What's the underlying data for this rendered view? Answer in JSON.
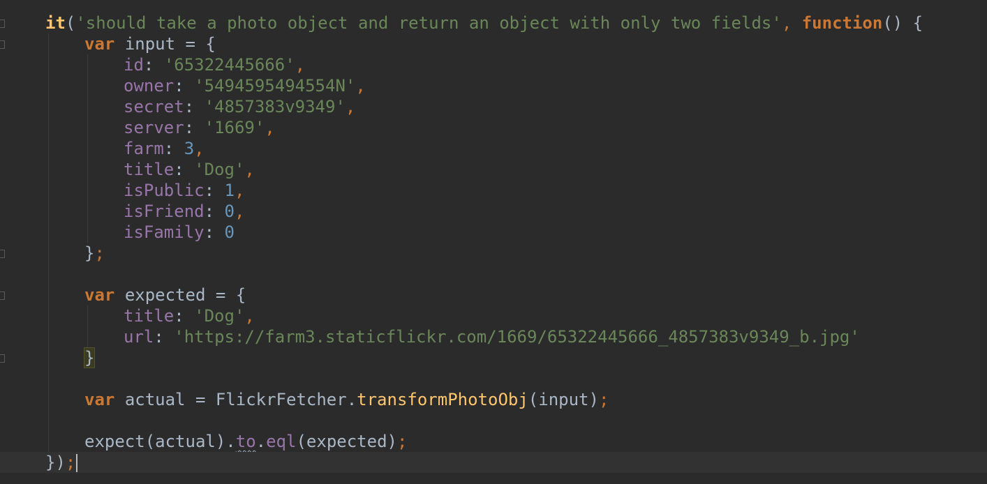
{
  "code": {
    "line1": {
      "it_fn": "it",
      "open_paren": "(",
      "description": "'should take a photo object and return an object with only two fields'",
      "comma": ",",
      "function_kw": "function",
      "parens_brace": "() {"
    },
    "line2": {
      "var_kw": "var",
      "decl": "input = {"
    },
    "input_props": [
      {
        "key": "id",
        "value": "'65322445666'",
        "sep": ",",
        "type": "string"
      },
      {
        "key": "owner",
        "value": "'5494595494554N'",
        "sep": ",",
        "type": "string"
      },
      {
        "key": "secret",
        "value": "'4857383v9349'",
        "sep": ",",
        "type": "string"
      },
      {
        "key": "server",
        "value": "'1669'",
        "sep": ",",
        "type": "string"
      },
      {
        "key": "farm",
        "value": "3",
        "sep": ",",
        "type": "number"
      },
      {
        "key": "title",
        "value": "'Dog'",
        "sep": ",",
        "type": "string"
      },
      {
        "key": "isPublic",
        "value": "1",
        "sep": ",",
        "type": "number"
      },
      {
        "key": "isFriend",
        "value": "0",
        "sep": ",",
        "type": "number"
      },
      {
        "key": "isFamily",
        "value": "0",
        "sep": "",
        "type": "number"
      }
    ],
    "input_close": {
      "brace": "}",
      "semi": ";"
    },
    "expected_decl": {
      "var_kw": "var",
      "decl": "expected = {"
    },
    "expected_props": [
      {
        "key": "title",
        "value": "'Dog'",
        "sep": ","
      },
      {
        "key": "url",
        "value": "'https://farm3.staticflickr.com/1669/65322445666_4857383v9349_b.jpg'",
        "sep": ""
      }
    ],
    "expected_close": {
      "brace": "}"
    },
    "actual_decl": {
      "var_kw": "var",
      "name": "actual = FlickrFetcher.",
      "method": "transformPhotoObj",
      "args": "(input)",
      "semi": ";"
    },
    "expect_line": {
      "expect": "expect(actual).",
      "to": "to",
      "dot": ".",
      "eql": "eql",
      "args": "(expected)",
      "semi": ";"
    },
    "last_line": {
      "close": "})",
      "semi": ";"
    }
  },
  "colors": {
    "background": "#2b2b2b",
    "current_line": "#323232",
    "keyword": "#cc7832",
    "string": "#6a8759",
    "property": "#9876aa",
    "number": "#6897bb",
    "function": "#ffc66d",
    "plain": "#a9b7c6"
  }
}
